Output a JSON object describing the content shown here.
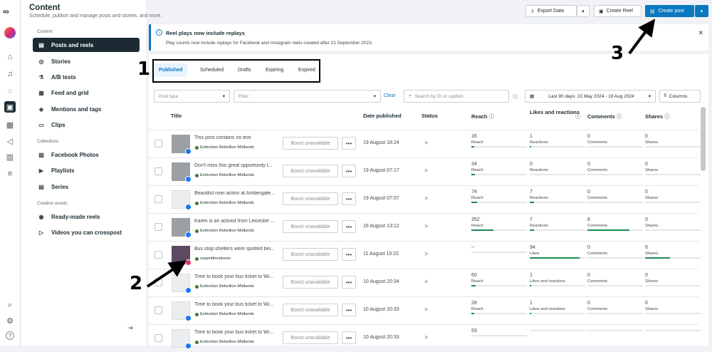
{
  "header": {
    "title": "Content",
    "subtitle": "Schedule, publish and manage posts and stories, and more."
  },
  "sidebar": {
    "sections": [
      {
        "label": "Content",
        "items": [
          {
            "label": "Posts and reels",
            "icon": "posts-icon",
            "active": true
          },
          {
            "label": "Stories",
            "icon": "stories-icon"
          },
          {
            "label": "A/B tests",
            "icon": "ab-test-icon"
          },
          {
            "label": "Feed and grid",
            "icon": "grid-icon"
          },
          {
            "label": "Mentions and tags",
            "icon": "tag-icon"
          },
          {
            "label": "Clips",
            "icon": "clip-icon"
          }
        ]
      },
      {
        "label": "Collections",
        "items": [
          {
            "label": "Facebook Photos",
            "icon": "photo-icon"
          },
          {
            "label": "Playlists",
            "icon": "playlist-icon"
          },
          {
            "label": "Series",
            "icon": "series-icon"
          }
        ]
      },
      {
        "label": "Creative assets",
        "items": [
          {
            "label": "Ready-made reels",
            "icon": "reels-icon"
          },
          {
            "label": "Videos you can crosspost",
            "icon": "video-icon"
          }
        ]
      }
    ]
  },
  "toolbar": {
    "export": "Export Data",
    "create_reel": "Create Reel",
    "create_post": "Create post"
  },
  "banner": {
    "title": "Reel plays now include replays",
    "text": "Play counts now include replays for Facebook and Instagram reels created after 21 September 2023."
  },
  "tabs": [
    "Published",
    "Scheduled",
    "Drafts",
    "Expiring",
    "Expired"
  ],
  "filters": {
    "post_type": "Post type",
    "filter": "Filter",
    "clear": "Clear",
    "search": "Search by ID or caption",
    "date_range": "Last 90 days: 22 May 2024 - 19 Aug 2024",
    "columns": "Columns"
  },
  "columns": {
    "title": "Title",
    "date": "Date published",
    "status": "Status",
    "reach": "Reach",
    "likes": "Likes and reactions",
    "comments": "Comments",
    "shares": "Shares"
  },
  "rows": [
    {
      "title": "This post contains no text",
      "account": "Extinction Rebellion Midlands",
      "platform": "facebook",
      "thumb": "dark-grey",
      "boost": "Boost unavailable",
      "date": "19 August 18:24",
      "reach": "16",
      "reach_l": "Reach",
      "reach_f": 0.05,
      "likes": "1",
      "likes_l": "Reactions",
      "likes_f": 0.02,
      "comments": "0",
      "comments_l": "Comments",
      "comments_f": 0,
      "shares": "0",
      "shares_l": "Shares",
      "shares_f": 0
    },
    {
      "title": "Don't miss this great opportunity t...",
      "account": "Extinction Rebellion Midlands",
      "platform": "facebook",
      "thumb": "dark-grey",
      "boost": "Boost unavailable",
      "date": "19 August 07:17",
      "reach": "34",
      "reach_l": "Reach",
      "reach_f": 0.06,
      "likes": "0",
      "likes_l": "Reactions",
      "likes_f": 0,
      "comments": "0",
      "comments_l": "Comments",
      "comments_f": 0,
      "shares": "0",
      "shares_l": "Shares",
      "shares_f": 0
    },
    {
      "title": "Beautiful river action at Ambergate...",
      "account": "Extinction Rebellion Midlands",
      "platform": "facebook",
      "thumb": "light",
      "boost": "Boost unavailable",
      "date": "19 August 07:07",
      "reach": "74",
      "reach_l": "Reach",
      "reach_f": 0.1,
      "likes": "7",
      "likes_l": "Reactions",
      "likes_f": 0.08,
      "comments": "0",
      "comments_l": "Comments",
      "comments_f": 0,
      "shares": "0",
      "shares_l": "Shares",
      "shares_f": 0
    },
    {
      "title": "Karen is an activist from Leicester ...",
      "account": "Extinction Rebellion Midlands",
      "platform": "facebook",
      "thumb": "grey",
      "boost": "Boost unavailable",
      "date": "16 August 13:12",
      "reach": "352",
      "reach_l": "Reach",
      "reach_f": 0.4,
      "likes": "7",
      "likes_l": "Reactions",
      "likes_f": 0.08,
      "comments": "6",
      "comments_l": "Comments",
      "comments_f": 0.75,
      "shares": "0",
      "shares_l": "Shares",
      "shares_f": 0
    },
    {
      "title": "Bus stop shelters were spotted bei...",
      "account": "xrpaintthestreets",
      "platform": "instagram",
      "thumb": "dark",
      "boost": "Boost unavailable",
      "date": "11 August 10:22",
      "reach": "--",
      "reach_l": "",
      "reach_f": 0,
      "likes": "94",
      "likes_l": "Likes",
      "likes_f": 0.9,
      "comments": "0",
      "comments_l": "Comments",
      "comments_f": 0,
      "shares": "6",
      "shares_l": "Shares",
      "shares_f": 0.45
    },
    {
      "title": "Time to book your bus ticket to Wi...",
      "account": "Extinction Rebellion Midlands",
      "platform": "facebook",
      "thumb": "light",
      "boost": "Boost unavailable",
      "date": "10 August 20:34",
      "reach": "60",
      "reach_l": "Reach",
      "reach_f": 0.08,
      "likes": "1",
      "likes_l": "Likes and reactions",
      "likes_f": 0.02,
      "comments": "0",
      "comments_l": "Comments",
      "comments_f": 0,
      "shares": "0",
      "shares_l": "Shares",
      "shares_f": 0
    },
    {
      "title": "Time to book your bus ticket to Wi...",
      "account": "Extinction Rebellion Midlands",
      "platform": "facebook",
      "thumb": "light",
      "boost": "Boost unavailable",
      "date": "10 August 20:33",
      "reach": "28",
      "reach_l": "Reach",
      "reach_f": 0.05,
      "likes": "1",
      "likes_l": "Likes and reactions",
      "likes_f": 0.02,
      "comments": "0",
      "comments_l": "Comments",
      "comments_f": 0,
      "shares": "0",
      "shares_l": "Shares",
      "shares_f": 0
    },
    {
      "title": "Time to book your bus ticket to Wi...",
      "account": "Extinction Rebellion Midlands",
      "platform": "facebook",
      "thumb": "light",
      "boost": "Boost unavailable",
      "date": "10 August 20:33",
      "reach": "53",
      "reach_l": "",
      "reach_f": 0,
      "likes": "",
      "likes_l": "",
      "likes_f": 0,
      "comments": "",
      "comments_l": "",
      "comments_f": 0,
      "shares": "",
      "shares_l": "",
      "shares_f": 0
    }
  ],
  "annotations": [
    "1",
    "2",
    "3"
  ],
  "colors": {
    "accent": "#0a78be",
    "metric_bar": "#1a8a55",
    "nav_active": "#1c2b33"
  }
}
